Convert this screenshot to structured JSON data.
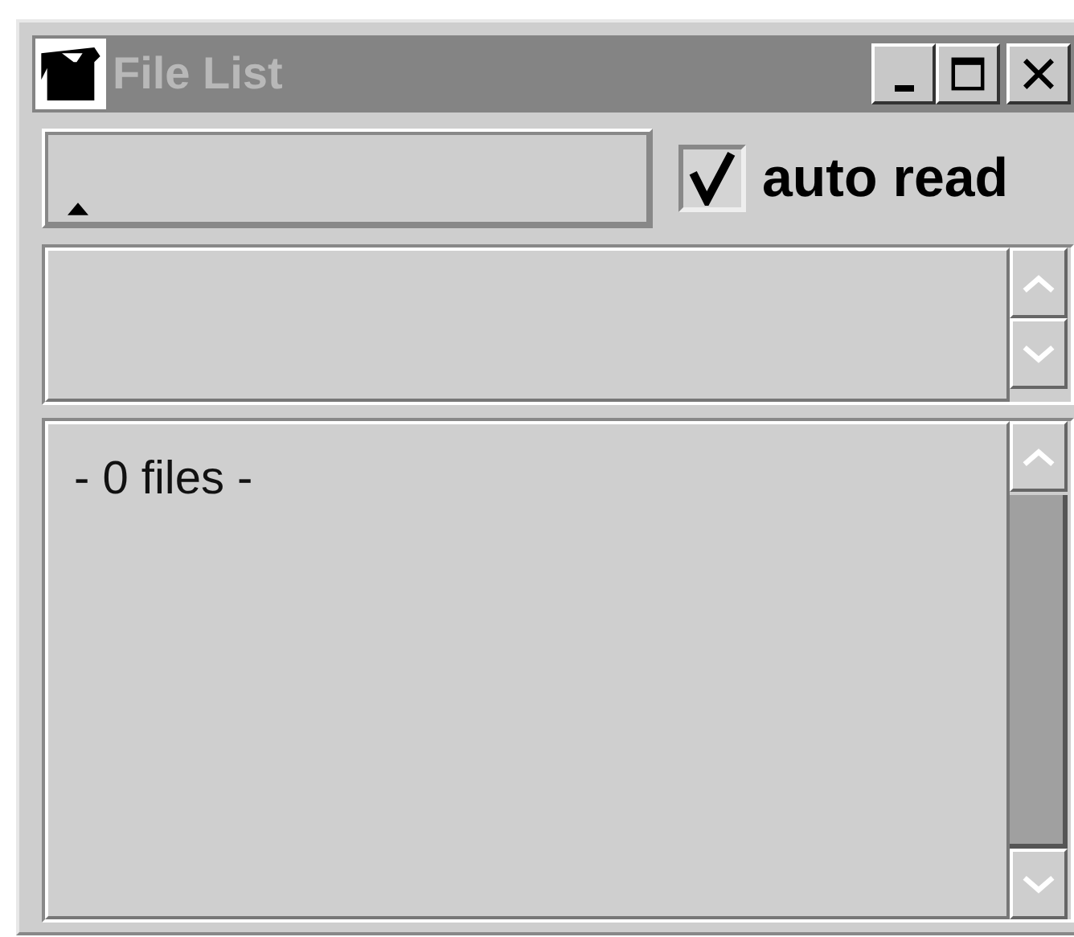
{
  "window": {
    "title": "File List"
  },
  "auto_read": {
    "label": "auto read",
    "checked": true
  },
  "file_list": {
    "status": "- 0 files -"
  }
}
